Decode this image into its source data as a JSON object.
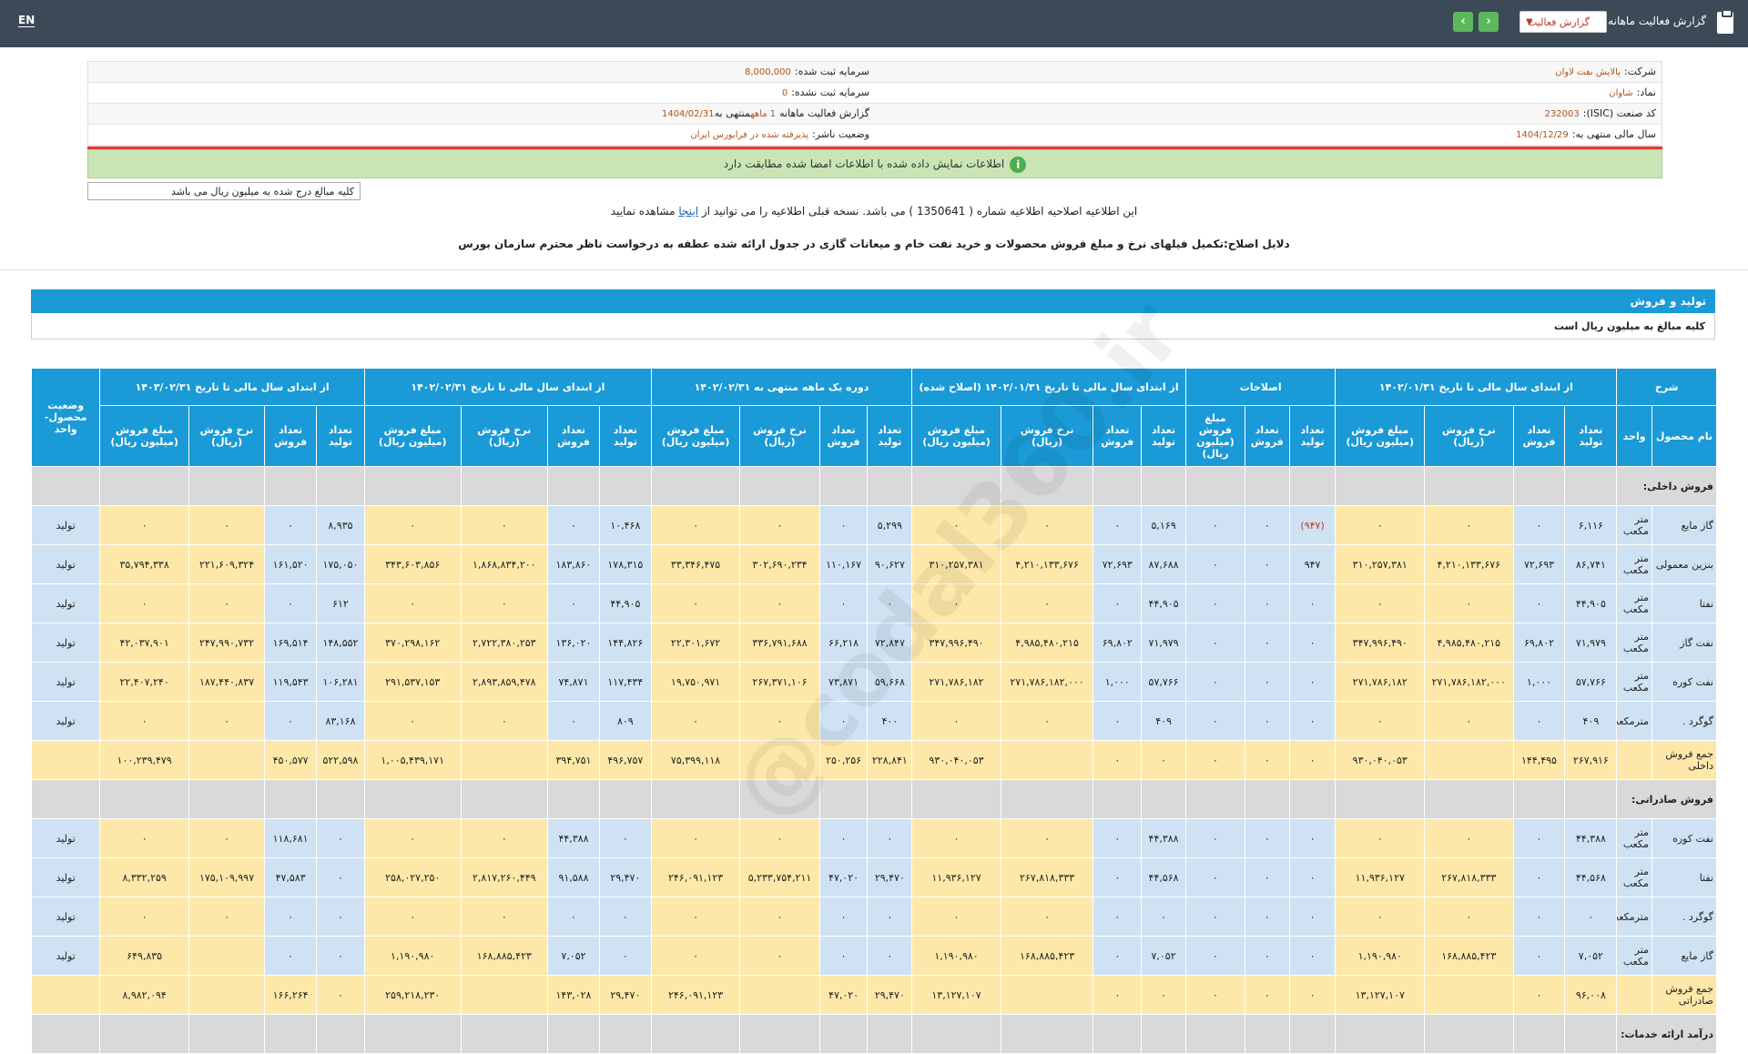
{
  "header": {
    "lang": "EN",
    "title": "گزارش فعالیت ماهانه",
    "report_select": "گزارش فعالیت",
    "prev_icon": "chevron-left-icon",
    "next_icon": "chevron-right-icon"
  },
  "info": {
    "company_label": "شرکت:",
    "company_value": "پالایش نفت لاوان",
    "capital_label": "سرمایه ثبت شده:",
    "capital_value": "8,000,000",
    "symbol_label": "نماد:",
    "symbol_value": "شاوان",
    "unreg_capital_label": "سرمایه ثبت نشده:",
    "unreg_capital_value": "0",
    "isic_label": "کد صنعت (ISIC):",
    "isic_value": "232003",
    "report_label": "گزارش فعالیت ماهانه",
    "report_value": "1 ماهه",
    "report_end_label": "منتهی به",
    "report_end_value": "1404/02/31",
    "fy_label": "سال مالی منتهی به:",
    "fy_value": "1404/12/29",
    "status_label": "وضعیت ناشر:",
    "status_value": "پذیرفته شده در فرابورس ایران"
  },
  "green_notice": "اطلاعات نمایش داده شده با اطلاعات امضا شده مطابقت دارد",
  "units_note": "کلیه مبالغ درج شده به میلیون ریال می باشد",
  "notice1_pre": "این اطلاعیه اصلاحیه اطلاعیه شماره ( 1350641 ) می باشد. نسخه قبلی اطلاعیه را می توانید از",
  "notice1_link": "اینجا",
  "notice1_post": "مشاهده نمایید",
  "notice2": "دلایل اصلاح:تکمیل فیلهای نرخ و مبلغ فروش محصولات و خرید نفت خام و میعانات گازی در جدول ارائه شده عطفه به درخواست ناظر محترم سازمان بورس",
  "watermark": "@codal360.ir",
  "section": {
    "title": "تولید و فروش",
    "subtitle": "کلیه مبالغ به میلیون ریال است"
  },
  "table": {
    "groups": [
      "شرح",
      "از ابتدای سال مالی تا تاریخ ۱۴۰۲/۰۱/۳۱",
      "اصلاحات",
      "از ابتدای سال مالی تا تاریخ ۱۴۰۲/۰۱/۳۱ (اصلاح شده)",
      "دوره یک ماهه منتهی به ۱۴۰۲/۰۲/۳۱",
      "از ابتدای سال مالی تا تاریخ ۱۴۰۲/۰۲/۳۱",
      "از ابتدای سال مالی تا تاریخ ۱۴۰۳/۰۲/۳۱",
      "وضعیت محصول- واحد"
    ],
    "sub": [
      "نام محصول",
      "واحد",
      "تعداد تولید",
      "تعداد فروش",
      "نرخ فروش (ریال)",
      "مبلغ فروش (میلیون ریال)",
      "تعداد تولید",
      "تعداد فروش",
      "مبلغ فروش (میلیون ریال)",
      "تعداد تولید",
      "تعداد فروش",
      "نرخ فروش (ریال)",
      "مبلغ فروش (میلیون ریال)",
      "تعداد تولید",
      "تعداد فروش",
      "نرخ فروش (ریال)",
      "مبلغ فروش (میلیون ریال)",
      "تعداد تولید",
      "تعداد فروش",
      "نرخ فروش (ریال)",
      "مبلغ فروش (میلیون ریال)",
      "تعداد تولید",
      "تعداد فروش",
      "نرخ فروش (ریال)",
      "مبلغ فروش (میلیون ریال)"
    ],
    "section_domestic": "فروش داخلی:",
    "rows_domestic": [
      [
        "گاز مایع",
        "متر مکعب",
        "۶,۱۱۶",
        "۰",
        "۰",
        "۰",
        "(۹۴۷)",
        "۰",
        "۰",
        "۵,۱۶۹",
        "۰",
        "۰",
        "۰",
        "۵,۲۹۹",
        "۰",
        "۰",
        "۰",
        "۱۰,۴۶۸",
        "۰",
        "۰",
        "۰",
        "۸,۹۳۵",
        "۰",
        "۰",
        "۰",
        "تولید"
      ],
      [
        "بنزین معمولی",
        "متر مکعب",
        "۸۶,۷۴۱",
        "۷۲,۶۹۳",
        "۴,۲۱۰,۱۳۳,۶۷۶",
        "۳۱۰,۲۵۷,۳۸۱",
        "۹۴۷",
        "۰",
        "۰",
        "۸۷,۶۸۸",
        "۷۲,۶۹۳",
        "۴,۲۱۰,۱۳۳,۶۷۶",
        "۳۱۰,۲۵۷,۳۸۱",
        "۹۰,۶۲۷",
        "۱۱۰,۱۶۷",
        "۳۰۲,۶۹۰,۲۳۴",
        "۳۳,۳۴۶,۴۷۵",
        "۱۷۸,۳۱۵",
        "۱۸۳,۸۶۰",
        "۱,۸۶۸,۸۳۴,۲۰۰",
        "۳۴۳,۶۰۳,۸۵۶",
        "۱۷۵,۰۵۰",
        "۱۶۱,۵۲۰",
        "۲۲۱,۶۰۹,۳۲۴",
        "۳۵,۷۹۴,۳۳۸",
        "تولید"
      ],
      [
        "نفتا",
        "متر مکعب",
        "۴۴,۹۰۵",
        "۰",
        "۰",
        "۰",
        "۰",
        "۰",
        "۰",
        "۴۴,۹۰۵",
        "۰",
        "۰",
        "۰",
        "۰",
        "۰",
        "۰",
        "۰",
        "۴۴,۹۰۵",
        "۰",
        "۰",
        "۰",
        "۶۱۲",
        "۰",
        "۰",
        "۰",
        "تولید"
      ],
      [
        "نفت گاز",
        "متر مکعب",
        "۷۱,۹۷۹",
        "۶۹,۸۰۲",
        "۴,۹۸۵,۴۸۰,۲۱۵",
        "۳۴۷,۹۹۶,۴۹۰",
        "۰",
        "۰",
        "۰",
        "۷۱,۹۷۹",
        "۶۹,۸۰۲",
        "۴,۹۸۵,۴۸۰,۲۱۵",
        "۳۴۷,۹۹۶,۴۹۰",
        "۷۲,۸۴۷",
        "۶۶,۲۱۸",
        "۳۳۶,۷۹۱,۶۸۸",
        "۲۲,۳۰۱,۶۷۲",
        "۱۴۴,۸۲۶",
        "۱۳۶,۰۲۰",
        "۲,۷۲۲,۳۸۰,۲۵۳",
        "۳۷۰,۲۹۸,۱۶۲",
        "۱۴۸,۵۵۲",
        "۱۶۹,۵۱۴",
        "۲۴۷,۹۹۰,۷۳۲",
        "۴۲,۰۳۷,۹۰۱",
        "تولید"
      ],
      [
        "نفت کوره",
        "متر مکعب",
        "۵۷,۷۶۶",
        "۱,۰۰۰",
        "۲۷۱,۷۸۶,۱۸۲,۰۰۰",
        "۲۷۱,۷۸۶,۱۸۲",
        "۰",
        "۰",
        "۰",
        "۵۷,۷۶۶",
        "۱,۰۰۰",
        "۲۷۱,۷۸۶,۱۸۲,۰۰۰",
        "۲۷۱,۷۸۶,۱۸۲",
        "۵۹,۶۶۸",
        "۷۳,۸۷۱",
        "۲۶۷,۳۷۱,۱۰۶",
        "۱۹,۷۵۰,۹۷۱",
        "۱۱۷,۴۳۴",
        "۷۴,۸۷۱",
        "۲,۸۹۳,۸۵۹,۴۷۸",
        "۲۹۱,۵۳۷,۱۵۳",
        "۱۰۶,۲۸۱",
        "۱۱۹,۵۴۳",
        "۱۸۷,۴۴۰,۸۳۷",
        "۲۲,۴۰۷,۲۴۰",
        "تولید"
      ],
      [
        "گوگرد .",
        "مترمکعب",
        "۴۰۹",
        "۰",
        "۰",
        "۰",
        "۰",
        "۰",
        "۰",
        "۴۰۹",
        "۰",
        "۰",
        "۰",
        "۴۰۰",
        "۰",
        "۰",
        "۰",
        "۸۰۹",
        "۰",
        "۰",
        "۰",
        "۸۳,۱۶۸",
        "۰",
        "۰",
        "۰",
        "تولید"
      ],
      [
        "جمع فروش داخلی",
        "",
        "۲۶۷,۹۱۶",
        "۱۴۴,۴۹۵",
        "",
        "۹۳۰,۰۴۰,۰۵۳",
        "۰",
        "۰",
        "۰",
        "۰",
        "۰",
        "",
        "۹۳۰,۰۴۰,۰۵۳",
        "۲۲۸,۸۴۱",
        "۲۵۰,۲۵۶",
        "",
        "۷۵,۳۹۹,۱۱۸",
        "۴۹۶,۷۵۷",
        "۳۹۴,۷۵۱",
        "",
        "۱,۰۰۵,۴۳۹,۱۷۱",
        "۵۲۲,۵۹۸",
        "۴۵۰,۵۷۷",
        "",
        "۱۰۰,۲۳۹,۴۷۹",
        ""
      ]
    ],
    "section_export": "فروش صادراتی:",
    "rows_export": [
      [
        "نفت کوره",
        "متر مکعب",
        "۴۴,۳۸۸",
        "۰",
        "۰",
        "۰",
        "۰",
        "۰",
        "۰",
        "۴۴,۳۸۸",
        "۰",
        "۰",
        "۰",
        "۰",
        "۰",
        "۰",
        "۰",
        "۰",
        "۴۴,۳۸۸",
        "۰",
        "۰",
        "۰",
        "۱۱۸,۶۸۱",
        "۰",
        "۰",
        "تولید"
      ],
      [
        "نفتا",
        "متر مکعب",
        "۴۴,۵۶۸",
        "۰",
        "۲۶۷,۸۱۸,۳۳۳",
        "۱۱,۹۳۶,۱۲۷",
        "۰",
        "۰",
        "۰",
        "۴۴,۵۶۸",
        "۰",
        "۲۶۷,۸۱۸,۳۳۳",
        "۱۱,۹۳۶,۱۲۷",
        "۲۹,۴۷۰",
        "۴۷,۰۲۰",
        "۵,۲۳۳,۷۵۴,۲۱۱",
        "۲۴۶,۰۹۱,۱۲۳",
        "۲۹,۴۷۰",
        "۹۱,۵۸۸",
        "۲,۸۱۷,۲۶۰,۴۴۹",
        "۲۵۸,۰۲۷,۲۵۰",
        "۰",
        "۴۷,۵۸۳",
        "۱۷۵,۱۰۹,۹۹۷",
        "۸,۳۳۲,۲۵۹",
        "تولید"
      ],
      [
        "گوگرد .",
        "مترمکعب",
        "۰",
        "۰",
        "۰",
        "۰",
        "۰",
        "۰",
        "۰",
        "۰",
        "۰",
        "۰",
        "۰",
        "۰",
        "۰",
        "۰",
        "۰",
        "۰",
        "۰",
        "۰",
        "۰",
        "۰",
        "۰",
        "۰",
        "۰",
        "تولید"
      ],
      [
        "گاز مایع",
        "متر مکعب",
        "۷,۰۵۲",
        "۰",
        "۱۶۸,۸۸۵,۴۲۳",
        "۱,۱۹۰,۹۸۰",
        "۰",
        "۰",
        "۰",
        "۷,۰۵۲",
        "۰",
        "۱۶۸,۸۸۵,۴۲۳",
        "۱,۱۹۰,۹۸۰",
        "۰",
        "۰",
        "۰",
        "۰",
        "۰",
        "۷,۰۵۲",
        "۱۶۸,۸۸۵,۴۲۳",
        "۱,۱۹۰,۹۸۰",
        "۰",
        "۰",
        "",
        "۶۴۹,۸۳۵",
        "تولید"
      ],
      [
        "جمع فروش صادراتی",
        "",
        "۹۶,۰۰۸",
        "۰",
        "",
        "۱۳,۱۲۷,۱۰۷",
        "۰",
        "۰",
        "۰",
        "۰",
        "۰",
        "",
        "۱۳,۱۲۷,۱۰۷",
        "۲۹,۴۷۰",
        "۴۷,۰۲۰",
        "",
        "۲۴۶,۰۹۱,۱۲۳",
        "۲۹,۴۷۰",
        "۱۴۳,۰۲۸",
        "",
        "۲۵۹,۲۱۸,۲۳۰",
        "۰",
        "۱۶۶,۲۶۴",
        "",
        "۸,۹۸۲,۰۹۴",
        ""
      ]
    ],
    "section_service": "درآمد ارائه خدمات:"
  }
}
